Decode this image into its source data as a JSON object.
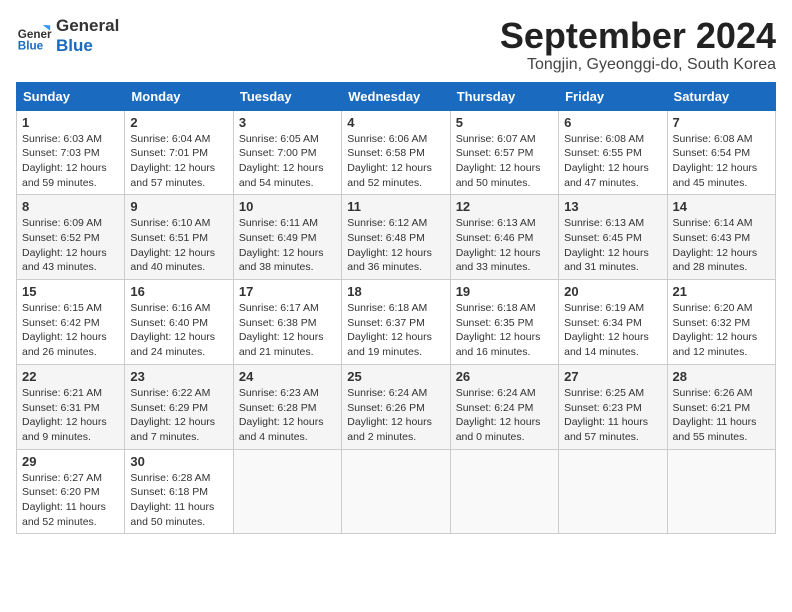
{
  "header": {
    "logo_line1": "General",
    "logo_line2": "Blue",
    "month_title": "September 2024",
    "location": "Tongjin, Gyeonggi-do, South Korea"
  },
  "weekdays": [
    "Sunday",
    "Monday",
    "Tuesday",
    "Wednesday",
    "Thursday",
    "Friday",
    "Saturday"
  ],
  "weeks": [
    [
      {
        "day": 1,
        "info": "Sunrise: 6:03 AM\nSunset: 7:03 PM\nDaylight: 12 hours\nand 59 minutes."
      },
      {
        "day": 2,
        "info": "Sunrise: 6:04 AM\nSunset: 7:01 PM\nDaylight: 12 hours\nand 57 minutes."
      },
      {
        "day": 3,
        "info": "Sunrise: 6:05 AM\nSunset: 7:00 PM\nDaylight: 12 hours\nand 54 minutes."
      },
      {
        "day": 4,
        "info": "Sunrise: 6:06 AM\nSunset: 6:58 PM\nDaylight: 12 hours\nand 52 minutes."
      },
      {
        "day": 5,
        "info": "Sunrise: 6:07 AM\nSunset: 6:57 PM\nDaylight: 12 hours\nand 50 minutes."
      },
      {
        "day": 6,
        "info": "Sunrise: 6:08 AM\nSunset: 6:55 PM\nDaylight: 12 hours\nand 47 minutes."
      },
      {
        "day": 7,
        "info": "Sunrise: 6:08 AM\nSunset: 6:54 PM\nDaylight: 12 hours\nand 45 minutes."
      }
    ],
    [
      {
        "day": 8,
        "info": "Sunrise: 6:09 AM\nSunset: 6:52 PM\nDaylight: 12 hours\nand 43 minutes."
      },
      {
        "day": 9,
        "info": "Sunrise: 6:10 AM\nSunset: 6:51 PM\nDaylight: 12 hours\nand 40 minutes."
      },
      {
        "day": 10,
        "info": "Sunrise: 6:11 AM\nSunset: 6:49 PM\nDaylight: 12 hours\nand 38 minutes."
      },
      {
        "day": 11,
        "info": "Sunrise: 6:12 AM\nSunset: 6:48 PM\nDaylight: 12 hours\nand 36 minutes."
      },
      {
        "day": 12,
        "info": "Sunrise: 6:13 AM\nSunset: 6:46 PM\nDaylight: 12 hours\nand 33 minutes."
      },
      {
        "day": 13,
        "info": "Sunrise: 6:13 AM\nSunset: 6:45 PM\nDaylight: 12 hours\nand 31 minutes."
      },
      {
        "day": 14,
        "info": "Sunrise: 6:14 AM\nSunset: 6:43 PM\nDaylight: 12 hours\nand 28 minutes."
      }
    ],
    [
      {
        "day": 15,
        "info": "Sunrise: 6:15 AM\nSunset: 6:42 PM\nDaylight: 12 hours\nand 26 minutes."
      },
      {
        "day": 16,
        "info": "Sunrise: 6:16 AM\nSunset: 6:40 PM\nDaylight: 12 hours\nand 24 minutes."
      },
      {
        "day": 17,
        "info": "Sunrise: 6:17 AM\nSunset: 6:38 PM\nDaylight: 12 hours\nand 21 minutes."
      },
      {
        "day": 18,
        "info": "Sunrise: 6:18 AM\nSunset: 6:37 PM\nDaylight: 12 hours\nand 19 minutes."
      },
      {
        "day": 19,
        "info": "Sunrise: 6:18 AM\nSunset: 6:35 PM\nDaylight: 12 hours\nand 16 minutes."
      },
      {
        "day": 20,
        "info": "Sunrise: 6:19 AM\nSunset: 6:34 PM\nDaylight: 12 hours\nand 14 minutes."
      },
      {
        "day": 21,
        "info": "Sunrise: 6:20 AM\nSunset: 6:32 PM\nDaylight: 12 hours\nand 12 minutes."
      }
    ],
    [
      {
        "day": 22,
        "info": "Sunrise: 6:21 AM\nSunset: 6:31 PM\nDaylight: 12 hours\nand 9 minutes."
      },
      {
        "day": 23,
        "info": "Sunrise: 6:22 AM\nSunset: 6:29 PM\nDaylight: 12 hours\nand 7 minutes."
      },
      {
        "day": 24,
        "info": "Sunrise: 6:23 AM\nSunset: 6:28 PM\nDaylight: 12 hours\nand 4 minutes."
      },
      {
        "day": 25,
        "info": "Sunrise: 6:24 AM\nSunset: 6:26 PM\nDaylight: 12 hours\nand 2 minutes."
      },
      {
        "day": 26,
        "info": "Sunrise: 6:24 AM\nSunset: 6:24 PM\nDaylight: 12 hours\nand 0 minutes."
      },
      {
        "day": 27,
        "info": "Sunrise: 6:25 AM\nSunset: 6:23 PM\nDaylight: 11 hours\nand 57 minutes."
      },
      {
        "day": 28,
        "info": "Sunrise: 6:26 AM\nSunset: 6:21 PM\nDaylight: 11 hours\nand 55 minutes."
      }
    ],
    [
      {
        "day": 29,
        "info": "Sunrise: 6:27 AM\nSunset: 6:20 PM\nDaylight: 11 hours\nand 52 minutes."
      },
      {
        "day": 30,
        "info": "Sunrise: 6:28 AM\nSunset: 6:18 PM\nDaylight: 11 hours\nand 50 minutes."
      },
      {
        "day": null,
        "info": ""
      },
      {
        "day": null,
        "info": ""
      },
      {
        "day": null,
        "info": ""
      },
      {
        "day": null,
        "info": ""
      },
      {
        "day": null,
        "info": ""
      }
    ]
  ]
}
